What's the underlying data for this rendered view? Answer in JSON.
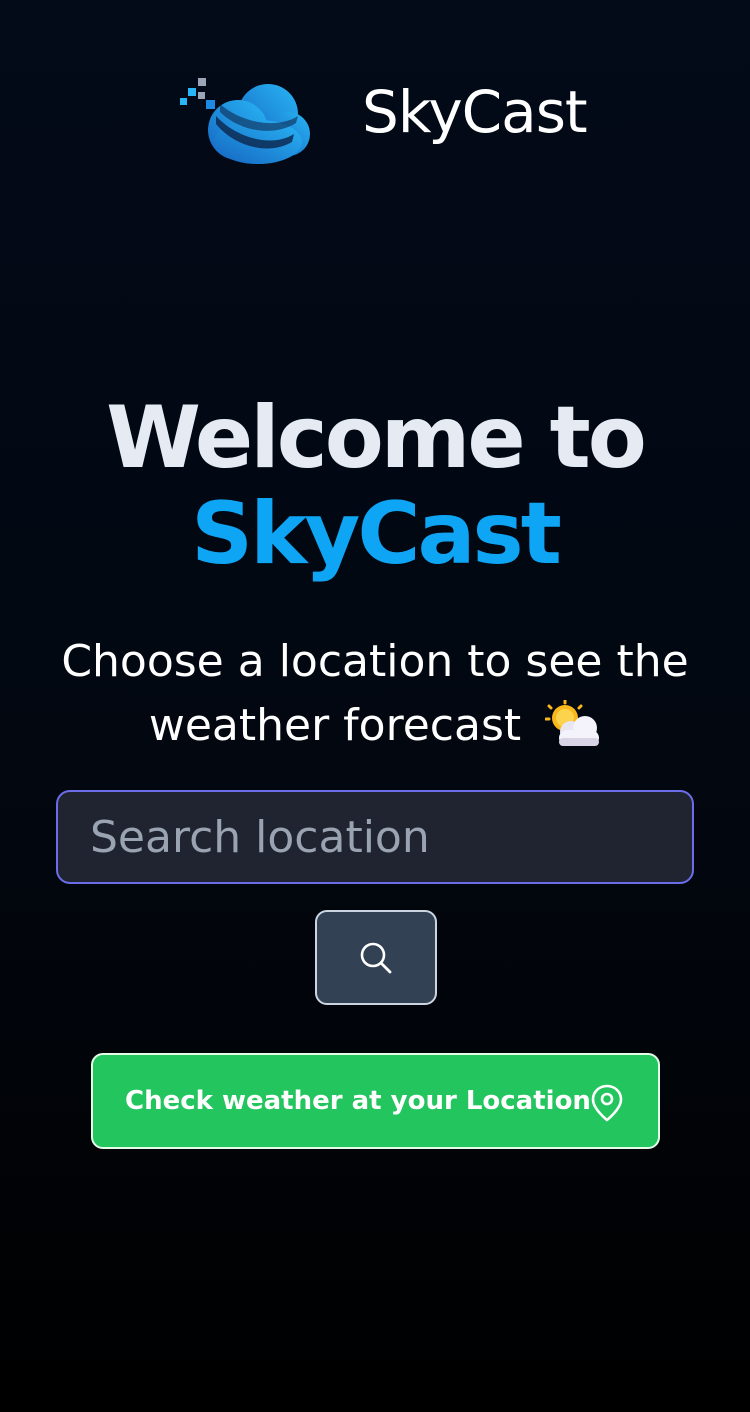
{
  "header": {
    "brand_name": "SkyCast",
    "logo_icon": "cloud-logo-icon"
  },
  "hero": {
    "line1": "Welcome to",
    "line2": "SkyCast",
    "accent_color": "#0ea5f5"
  },
  "subtitle": {
    "line1": "Choose a location to see the",
    "line2": "weather forecast",
    "emoji_icon": "sun-behind-cloud-icon"
  },
  "search": {
    "placeholder": "Search location",
    "value": "",
    "button_icon": "search-icon"
  },
  "location_button": {
    "label": "Check weather at your Location",
    "icon": "map-pin-icon",
    "color": "#22c55e"
  }
}
